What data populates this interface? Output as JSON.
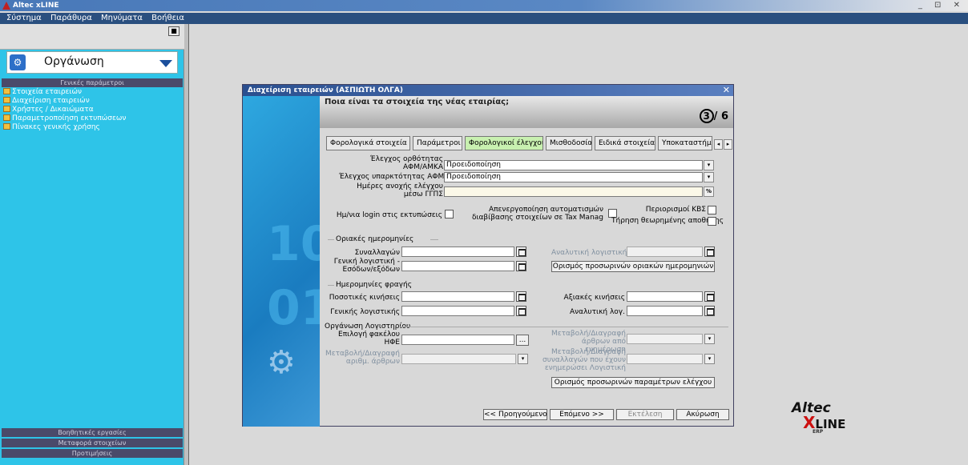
{
  "app": {
    "title": "Altec xLINE",
    "window_controls": "_ ⊡ ✕"
  },
  "menu": [
    "Σύστημα",
    "Παράθυρα",
    "Μηνύματα",
    "Βοήθεια"
  ],
  "left_panel": {
    "close_label": "■",
    "module_title": "Οργάνωση",
    "section_top": "Γενικές παράμετροι",
    "items": [
      "Στοιχεία εταιρειών",
      "Διαχείριση εταιρειών",
      "Χρήστες / Δικαιώματα",
      "Παραμετροποίηση εκτυπώσεων",
      "Πίνακες γενικής χρήσης"
    ],
    "bottom_sections": [
      "Βοηθητικές εργασίες",
      "Μεταφορά στοιχείων",
      "Προτιμήσεις"
    ]
  },
  "dialog": {
    "title": "Διαχείριση εταιρειών (ΑΣΠΙΩΤΗ  ΟΛΓΑ)",
    "question": "Ποια είναι τα στοιχεία της νέας εταιρίας;",
    "step_current": "3",
    "step_total": "/ 6",
    "tabs": [
      "Φορολογικά στοιχεία",
      "Παράμετροι",
      "Φορολογικοί έλεγχοι",
      "Μισθοδοσία",
      "Ειδικά στοιχεία",
      "Υποκαταστήμ"
    ],
    "fields": {
      "afm_check_label": "Έλεγχος ορθότητας ΑΦΜ/ΑΜΚΑ",
      "afm_check_value": "Προειδοποίηση",
      "afm_exist_label": "Έλεγχος υπαρκτότητας ΑΦΜ",
      "afm_exist_value": "Προειδοποίηση",
      "ggps_label": "Ημέρες ανοχής ελέγχου μέσω ΓΓΠΣ",
      "login_print_label": "Ημ/νια login στις εκτυπώσεις",
      "auto_disable_label": "Απενεργοποίηση αυτοματισμών διαβίβασης στοιχείων σε Tax Manag",
      "kvs_label": "Περιορισμοί ΚΒΣ",
      "storage_label": "Τήρηση θεωρημένης αποθήκης"
    },
    "group_limits": "Οριακές ημερομηνίες",
    "transactions_label": "Συναλλαγών",
    "general_ledger_label": "Γενική λογιστική - Εσόδων/εξόδων",
    "analytic_label": "Αναλυτική λογιστική",
    "temp_limits_button": "Ορισμός προσωρινών οριακών ημερομηνιών",
    "group_close": "Ημερομηνίες φραγής",
    "qty_moves_label": "Ποσοτικές κινήσεις",
    "value_moves_label": "Αξιακές κινήσεις",
    "general_acc_label": "Γενικής λογιστικής",
    "analytic_acc_label": "Αναλυτική λογ.",
    "group_org": "Οργάνωση Λογιστηρίου",
    "folder_label": "Επιλογή φακέλου ΗΦΕ",
    "browse_label": "...",
    "modify_articles_label": "Μεταβολή/Διαγραφή άρθρων από ενημέρωση",
    "modify_numbers_label": "Μεταβολή/Διαγραφή αριθμ. άρθρων",
    "modify_transactions_label": "Μεταβολή/Διαγραφή συναλλαγών που έχουν ενημερώσει Λογιστική",
    "temp_params_button": "Ορισμός προσωρινών παραμέτρων ελέγχου",
    "buttons": {
      "prev": "<< Προηγούμενο",
      "next": "Επόμενο >>",
      "run": "Εκτέλεση",
      "cancel": "Ακύρωση"
    }
  },
  "brand": {
    "name": "Altec",
    "x": "X",
    "line": "LINE",
    "erp": "ERP"
  }
}
